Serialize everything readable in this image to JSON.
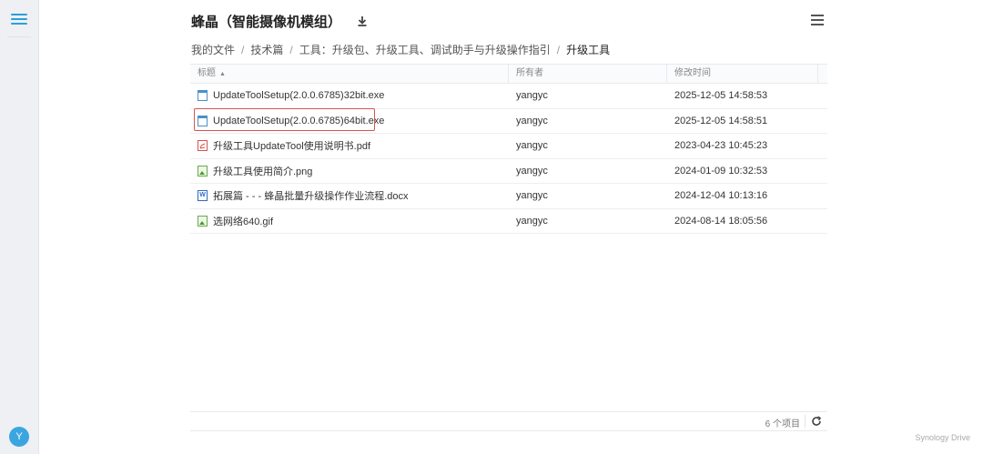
{
  "header": {
    "title": "蜂晶（智能摄像机模组）"
  },
  "breadcrumb": {
    "items": [
      "我的文件",
      "技术篇",
      "工具：升级包、升级工具、调试助手与升级操作指引"
    ],
    "separator": "/",
    "current": "升级工具"
  },
  "table": {
    "columns": [
      "标题",
      "所有者",
      "修改时间"
    ],
    "rows": [
      {
        "name": "UpdateToolSetup(2.0.0.6785)32bit.exe",
        "owner": "yangyc",
        "modified": "2025-12-05 14:58:53",
        "icon": "exe-file-icon"
      },
      {
        "name": "UpdateToolSetup(2.0.0.6785)64bit.exe",
        "owner": "yangyc",
        "modified": "2025-12-05 14:58:51",
        "icon": "exe-file-icon"
      },
      {
        "name": "升级工具UpdateTool使用说明书.pdf",
        "owner": "yangyc",
        "modified": "2023-04-23 10:45:23",
        "icon": "pdf-file-icon"
      },
      {
        "name": "升级工具使用简介.png",
        "owner": "yangyc",
        "modified": "2024-01-09 10:32:53",
        "icon": "image-file-icon"
      },
      {
        "name": "拓展篇 - - - 蜂晶批量升级操作作业流程.docx",
        "owner": "yangyc",
        "modified": "2024-12-04 10:13:16",
        "icon": "word-file-icon"
      },
      {
        "name": "选网络640.gif",
        "owner": "yangyc",
        "modified": "2024-08-14 18:05:56",
        "icon": "image-file-icon"
      }
    ]
  },
  "footer": {
    "count": "6 个项目"
  },
  "user": {
    "avatar_letter": "Y"
  },
  "brand": "Synology Drive",
  "colors": {
    "accent": "#2b9fd9",
    "highlight": "#d9534f",
    "avatar": "#3ba5e0"
  }
}
